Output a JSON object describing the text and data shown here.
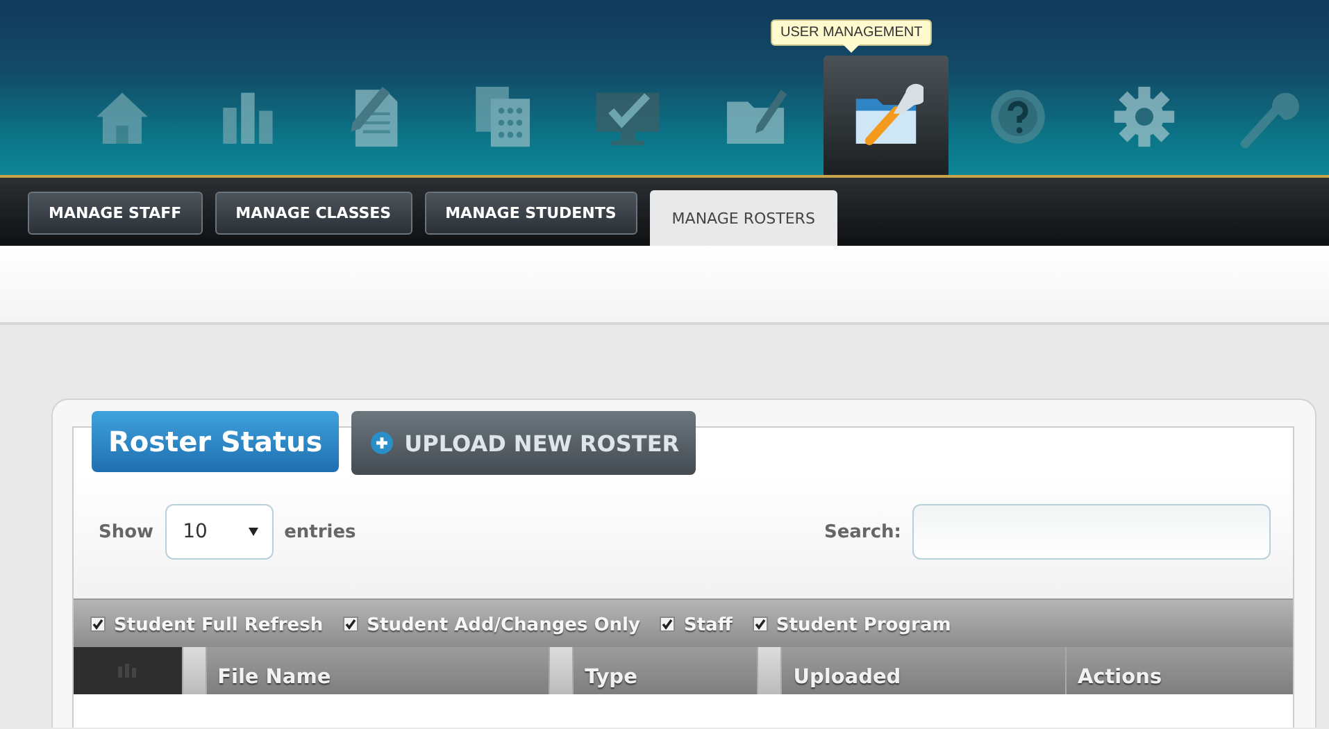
{
  "nav": {
    "tooltip": "USER MANAGEMENT",
    "items": [
      {
        "selected": false
      },
      {
        "selected": false
      },
      {
        "selected": false
      },
      {
        "selected": false
      },
      {
        "selected": false
      },
      {
        "selected": false
      },
      {
        "selected": true
      },
      {
        "selected": false
      },
      {
        "selected": false
      },
      {
        "selected": false
      }
    ]
  },
  "subtabs": [
    {
      "label": "MANAGE STAFF",
      "selected": false
    },
    {
      "label": "MANAGE CLASSES",
      "selected": false
    },
    {
      "label": "MANAGE STUDENTS",
      "selected": false
    },
    {
      "label": "MANAGE ROSTERS",
      "selected": true
    }
  ],
  "panel": {
    "tabs": [
      {
        "label": "Roster Status",
        "selected": true
      },
      {
        "label": "UPLOAD NEW ROSTER",
        "selected": false
      }
    ],
    "show_label": "Show",
    "page_size": "10",
    "entries_label": "entries",
    "search_label": "Search:",
    "filters": [
      {
        "label": "Student Full Refresh",
        "checked": true
      },
      {
        "label": "Student Add/Changes Only",
        "checked": true
      },
      {
        "label": "Staff",
        "checked": true
      },
      {
        "label": "Student Program",
        "checked": true
      }
    ],
    "columns": [
      {
        "label": "File Name",
        "sortable": true
      },
      {
        "label": "Type",
        "sortable": true
      },
      {
        "label": "Uploaded",
        "sortable": true
      },
      {
        "label": "Actions",
        "sortable": false
      }
    ]
  }
}
